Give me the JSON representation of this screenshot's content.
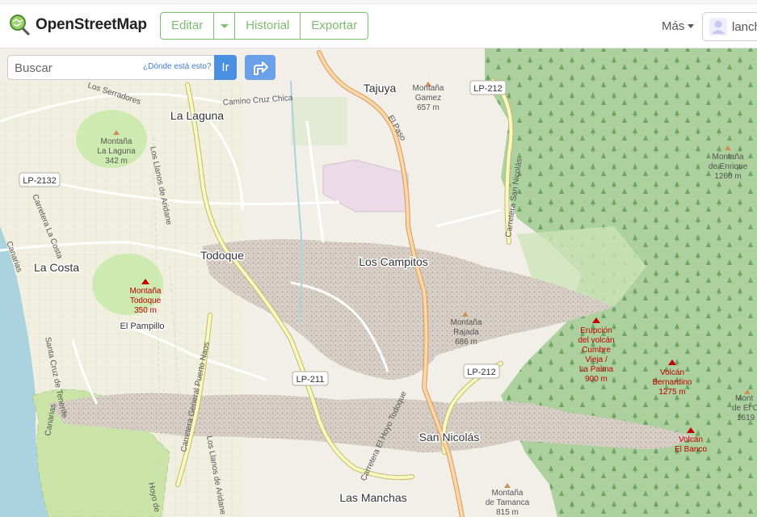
{
  "header": {
    "title": "OpenStreetMap",
    "buttons": {
      "edit": "Editar",
      "history": "Historial",
      "export": "Exportar"
    },
    "more": "Más",
    "user": "lanch"
  },
  "search": {
    "placeholder": "Buscar",
    "where": "¿Dónde está esto?",
    "go": "Ir"
  },
  "map": {
    "roads": {
      "lp212a": "LP-212",
      "lp2132": "LP-2132",
      "lp211": "LP-211",
      "lp212b": "LP-212"
    },
    "places": {
      "tajuya": "Tajuya",
      "la_laguna": "La Laguna",
      "todoque": "Todoque",
      "los_campitos": "Los Campitos",
      "la_costa": "La Costa",
      "el_pampillo": "El Pampillo",
      "san_nicolas": "San Nicolás",
      "las_manchas": "Las Manchas"
    },
    "streets": {
      "camino_cruz_chica": "Camino Cruz Chica",
      "los_serradores": "Los Serradores",
      "el_paso": "El Paso",
      "llanos_aridane_1": "Los Llanos de Aridane",
      "llanos_aridane_2": "Los Llanos de Aridane",
      "carretera_la_costa": "Carretera La Costa",
      "carretera_san_nicolas": "Carretera San Nicolás",
      "carretera_general": "Carretera General Puerto Naos",
      "carretera_hoyo": "Carretera El Hoyo Todoque",
      "canarias": "Canarias",
      "santa_cruz": "Santa Cruz de Tenerife",
      "canarias2": "Canarias",
      "hoyo_de": "Hoyo de"
    },
    "peaks": {
      "gamez": [
        "Montaña",
        "Gamez",
        "657 m"
      ],
      "laguna": [
        "Montaña",
        "La Laguna",
        "342 m"
      ],
      "enrique": [
        "Montaña",
        "de Enrique",
        "1260 m"
      ],
      "todoque": [
        "Montaña",
        "Todoque",
        "350 m"
      ],
      "rajada": [
        "Montaña",
        "Rajada",
        "686 m"
      ],
      "erupcion": [
        "Erupción",
        "del volcán",
        "Cumbre",
        "Vieja /",
        "La Palma",
        "900 m"
      ],
      "bernardino": [
        "Volcán",
        "Bernardino",
        "1275 m"
      ],
      "el_c": [
        "Mont",
        "de El C",
        "1619"
      ],
      "el_banco": [
        "Volcán",
        "El Banco"
      ],
      "tamanca": [
        "Montaña",
        "de Tamanca",
        "815 m"
      ]
    }
  },
  "colors": {
    "accent": "#7ebc6f",
    "road_yellow": "#f7fabf",
    "primary_road": "#fcd6a4",
    "forest": "#add19e",
    "sea": "#aad3df",
    "lava": "#d9d0c9",
    "farmland": "#eef0d5",
    "peak_red": "#c00000"
  }
}
